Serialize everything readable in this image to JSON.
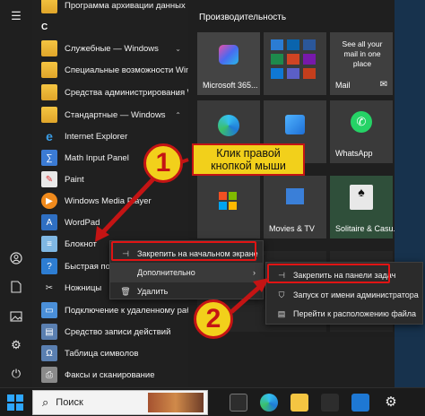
{
  "app_list": {
    "section_letter": "С",
    "items": [
      {
        "label": "Программа архивации данных",
        "icon": "folder-icon"
      },
      {
        "label": "Служебные — Windows",
        "icon": "folder-icon"
      },
      {
        "label": "Специальные возможности Windows",
        "icon": "folder-icon"
      },
      {
        "label": "Средства администрирования Windows",
        "icon": "folder-icon"
      },
      {
        "label": "Стандартные — Windows",
        "icon": "folder-icon"
      },
      {
        "label": "Internet Explorer",
        "icon": "internet-explorer-icon"
      },
      {
        "label": "Math Input Panel",
        "icon": "math-input-icon"
      },
      {
        "label": "Paint",
        "icon": "paint-icon"
      },
      {
        "label": "Windows Media Player",
        "icon": "media-player-icon"
      },
      {
        "label": "WordPad",
        "icon": "wordpad-icon"
      },
      {
        "label": "Блокнот",
        "icon": "notepad-icon"
      },
      {
        "label": "Быстрая помощь",
        "icon": "quick-assist-icon"
      },
      {
        "label": "Ножницы",
        "icon": "scissors-icon"
      },
      {
        "label": "Подключение к удаленному рабочему столу",
        "icon": "remote-desktop-icon"
      },
      {
        "label": "Средство записи действий",
        "icon": "steps-recorder-icon"
      },
      {
        "label": "Таблица символов",
        "icon": "character-map-icon"
      },
      {
        "label": "Факсы и сканирование",
        "icon": "fax-scan-icon"
      }
    ]
  },
  "tiles": {
    "group_title": "Производительность",
    "items": [
      {
        "label": "Microsoft 365...",
        "color": "#4a4a4a"
      },
      {
        "label": "",
        "color": "#3a3a3a"
      },
      {
        "label": "Mail",
        "color": "#3a3a3a"
      },
      {
        "label": "",
        "color": "#3a3a3a"
      },
      {
        "label": "",
        "color": "#3a3a3a"
      },
      {
        "label": "WhatsApp",
        "color": "#3a3a3a"
      },
      {
        "label": "",
        "color": "#3a3a3a"
      },
      {
        "label": "Movies & TV",
        "color": "#3a3a3a"
      },
      {
        "label": "Solitaire & Casu...",
        "color": "#3a3a3a"
      }
    ],
    "mail_text": "See all your mail in one place"
  },
  "context_menu": {
    "items": [
      {
        "label": "Закрепить на начальном экране",
        "icon": "pin-icon"
      },
      {
        "label": "Дополнительно",
        "icon": ""
      },
      {
        "label": "Удалить",
        "icon": "trash-icon"
      }
    ]
  },
  "submenu": {
    "items": [
      {
        "label": "Закрепить на панели задач",
        "icon": "pin-icon"
      },
      {
        "label": "Запуск от имени администратора",
        "icon": "shield-icon"
      },
      {
        "label": "Перейти к расположению файла",
        "icon": "file-location-icon"
      }
    ]
  },
  "callout": {
    "line1": "Клик правой",
    "line2": "кнопкой мыши"
  },
  "badges": {
    "one": "1",
    "two": "2"
  },
  "taskbar": {
    "search_placeholder": "Поиск"
  },
  "colors": {
    "accent": "#c41414",
    "badge": "#f2d01b",
    "start_blue": "#2ea7ff"
  }
}
